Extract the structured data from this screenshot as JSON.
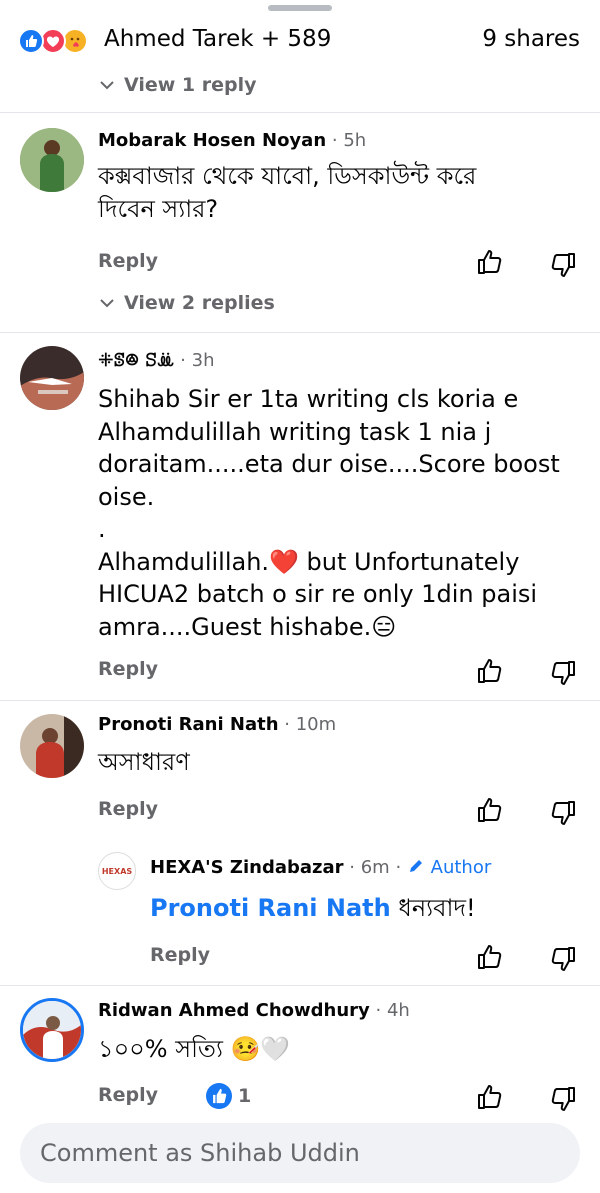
{
  "header": {
    "reactor_text": "Ahmed Tarek + 589",
    "shares_text": "9 shares",
    "reaction_icons": [
      "like-icon",
      "love-icon",
      "care-icon"
    ]
  },
  "thread_top": {
    "view_replies": "View 1 reply"
  },
  "comments": [
    {
      "name": "Mobarak Hosen Noyan",
      "time": "5h",
      "text_lines": [
        "কক্সবাজার থেকে যাবো, ডিসকাউন্ট করে",
        "দিবেন স্যার?"
      ],
      "reply_label": "Reply",
      "view_replies": "View 2 replies"
    },
    {
      "name": "ꔰꕷꔮ ꕶꔣ",
      "time": "3h",
      "text_lines": [
        "Shihab Sir er 1ta writing cls koria e",
        "Alhamdulillah writing task 1 nia j",
        "doraitam.....eta dur oise....Score boost",
        "oise.",
        ".",
        "Alhamdulillah.❤️ but Unfortunately",
        "HICUA2 batch o sir re only 1din paisi",
        "amra....Guest hishabe.😑"
      ],
      "reply_label": "Reply"
    },
    {
      "name": "Pronoti Rani Nath",
      "time": "10m",
      "text_lines": [
        "অসাধারণ"
      ],
      "reply_label": "Reply"
    },
    {
      "name": "Ridwan Ahmed Chowdhury",
      "time": "4h",
      "text_lines": [
        "১০০% সত্যি 🤒🤍"
      ],
      "reply_label": "Reply",
      "like_count": "1"
    }
  ],
  "nested_reply": {
    "name": "HEXA'S Zindabazar",
    "time": "6m",
    "author_label": "Author",
    "avatar_text": "HEXAS",
    "mention": "Pronoti Rani Nath",
    "text": "ধন্যবাদ!",
    "reply_label": "Reply"
  },
  "composer": {
    "placeholder": "Comment as Shihab Uddin"
  },
  "colors": {
    "accent": "#1877f2",
    "muted": "#65676b",
    "love": "#f33e58",
    "composer_bg": "#f0f2f5"
  }
}
